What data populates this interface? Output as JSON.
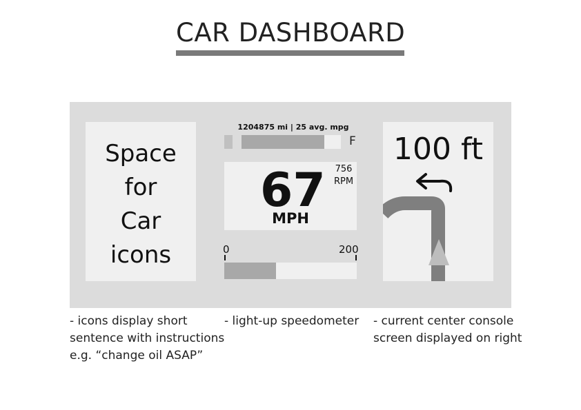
{
  "title": "CAR DASHBOARD",
  "left_panel": {
    "lines": [
      "Space",
      "for",
      "Car",
      "icons"
    ]
  },
  "center": {
    "odometer": "1204875 mi | 25 avg. mpg",
    "fuel_label": "F",
    "fuel_level": 0.83,
    "speed": "67",
    "speed_unit": "MPH",
    "rpm_value": "756",
    "rpm_label": "RPM",
    "scale_min": "0",
    "scale_max": "200",
    "speedometer_level": 0.39
  },
  "nav": {
    "distance": "100 ft",
    "turn_icon": "left-turn-arrow-icon"
  },
  "notes": {
    "left": [
      "- icons display short",
      "sentence with instructions",
      "e.g. “change oil ASAP”"
    ],
    "center": [
      "- light-up speedometer"
    ],
    "right": [
      "- current center console",
      "screen displayed on right"
    ]
  },
  "colors": {
    "title_bar": "#7a7a7a",
    "dashboard_bg": "#dcdcdc",
    "panel_bg": "#f0f0f0",
    "fill": "#a8a8a8",
    "route": "#7f7f7f",
    "arrow": "#bdbdbd"
  }
}
